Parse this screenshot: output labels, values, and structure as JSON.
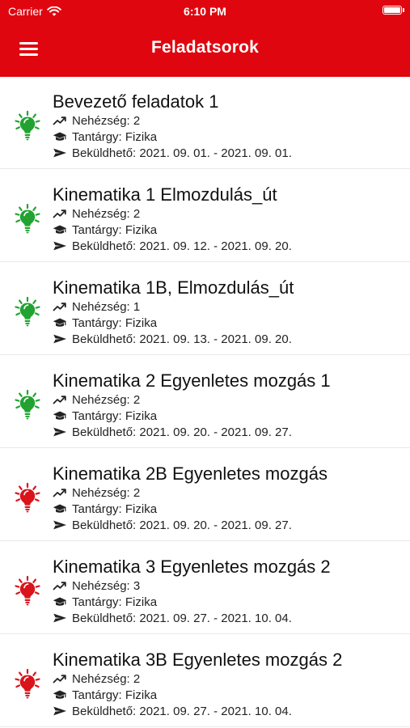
{
  "status_bar": {
    "carrier": "Carrier",
    "time": "6:10 PM"
  },
  "header": {
    "title": "Feladatsorok"
  },
  "colors": {
    "brand_red": "#e0060f",
    "open_green": "#22a331",
    "closed_red": "#d9141b"
  },
  "icons": {
    "menu": "hamburger-menu-icon",
    "task": "lightbulb-icon",
    "difficulty": "trending-up-icon",
    "subject": "graduation-cap-icon",
    "deadline": "send-icon"
  },
  "tasks": [
    {
      "title": "Bevezető feladatok 1",
      "difficulty": "Nehézség: 2",
      "subject": "Tantárgy: Fizika",
      "deadline": "Beküldhető: 2021. 09. 01. - 2021. 09. 01.",
      "status": "green"
    },
    {
      "title": "Kinematika 1 Elmozdulás_út",
      "difficulty": "Nehézség: 2",
      "subject": "Tantárgy: Fizika",
      "deadline": "Beküldhető: 2021. 09. 12. - 2021. 09. 20.",
      "status": "green"
    },
    {
      "title": "Kinematika 1B, Elmozdulás_út",
      "difficulty": "Nehézség: 1",
      "subject": "Tantárgy: Fizika",
      "deadline": "Beküldhető: 2021. 09. 13. - 2021. 09. 20.",
      "status": "green"
    },
    {
      "title": "Kinematika 2 Egyenletes mozgás 1",
      "difficulty": "Nehézség: 2",
      "subject": "Tantárgy: Fizika",
      "deadline": "Beküldhető: 2021. 09. 20. - 2021. 09. 27.",
      "status": "green"
    },
    {
      "title": "Kinematika 2B Egyenletes mozgás",
      "difficulty": "Nehézség: 2",
      "subject": "Tantárgy: Fizika",
      "deadline": "Beküldhető: 2021. 09. 20. - 2021. 09. 27.",
      "status": "red"
    },
    {
      "title": "Kinematika 3 Egyenletes mozgás 2",
      "difficulty": "Nehézség: 3",
      "subject": "Tantárgy: Fizika",
      "deadline": "Beküldhető: 2021. 09. 27. - 2021. 10. 04.",
      "status": "red"
    },
    {
      "title": "Kinematika 3B Egyenletes mozgás 2",
      "difficulty": "Nehézség: 2",
      "subject": "Tantárgy: Fizika",
      "deadline": "Beküldhető: 2021. 09. 27. - 2021. 10. 04.",
      "status": "red"
    }
  ]
}
